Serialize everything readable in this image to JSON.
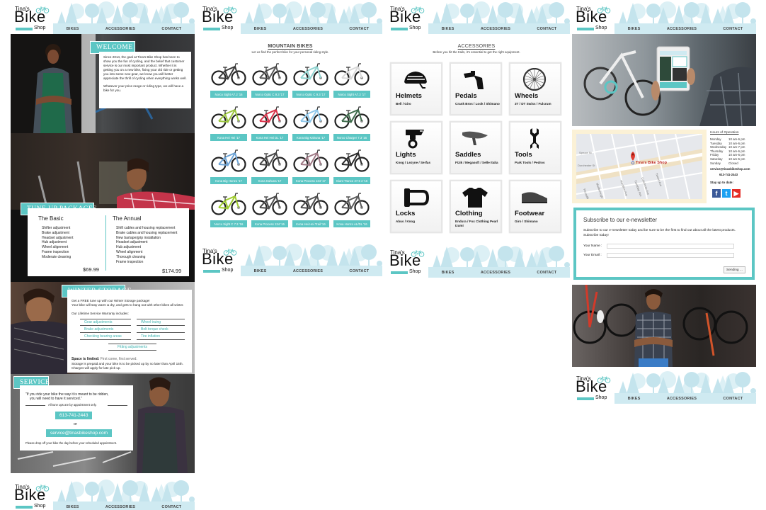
{
  "brand": {
    "name_top": "Tina's",
    "name_main": "Bike",
    "name_bottom": "Shop"
  },
  "nav": {
    "items": [
      "BIKES",
      "ACCESSORIES",
      "CONTACT"
    ]
  },
  "colors": {
    "accent": "#5cc6c4",
    "nav_band": "#cfeaf1",
    "tree_light": "#c9e6ee",
    "map_frame": "#fbf1d6"
  },
  "home": {
    "welcome": {
      "title": "WELCOME",
      "paragraph1": "Since 2014, the goal at Tina's Bike Shop has been to show you the fun of cycling, and the belief that customer service is our most important product. Whether it is getting you on a new bike, fixing your old ride or getting you into some new gear, we know you will better appreciate the thrill of cycling when everything works well.",
      "paragraph2": "Whatever your price range or riding type, we will have a bike for you."
    },
    "tuneup": {
      "title": "TUNE UP PACKAGES",
      "basic": {
        "name": "The Basic",
        "items": [
          "Shifter adjustment",
          "Brake adjustment",
          "Headset adjustment",
          "Hub adjustment",
          "Wheel alignment",
          "Frame inspection",
          "Moderate cleaning"
        ],
        "price": "$69.99"
      },
      "annual": {
        "name": "The Annual",
        "items": [
          "Shift cables and housing replacement",
          "Brake cables and housing replacement",
          "New bartape/grip installation",
          "Headset adjustment",
          "Hub adjustment",
          "Wheel alignment",
          "Thorough cleaning",
          "Frame inspection"
        ],
        "price": "$174.99"
      }
    },
    "winter": {
      "title": "WINTER STORAGE",
      "intro1": "Get a FREE tune up with our Winter Storage package!",
      "intro2": "Your bike will stay warm & dry, and gets to hang out with other bikes all winter.",
      "warranty_heading": "Our Lifetime Service Warranty includes:",
      "warranty_items": [
        "Gear adjustments",
        "Wheel truing",
        "Brake adjustments",
        "Bolt torque check",
        "Checking bearing areas",
        "Tire inflation",
        "Fitting adjustments"
      ],
      "limited_bold": "Space is limited:",
      "limited_rest": " First come, first served.",
      "note1": "Storage is prepaid and your bike is to be picked up by no later than April 15th.",
      "note2": "Charges will apply for late pick up."
    },
    "service": {
      "title": "SERVICE",
      "quote1": "\"If you ride your bike the way it is meant to be ridden,",
      "quote2": "you will need to have it serviced.\"",
      "appointment": "All tune ups are by appointment only.",
      "phone": "613-741-2443",
      "or": "or",
      "email": "service@tinasbikeshop.com",
      "dropoff": "Please drop off your bike the day before your scheduled appointment."
    }
  },
  "bikes": {
    "title": "MOUNTAIN BIKES",
    "subtitle": "Let us find the perfect bike for your personal riding style.",
    "items": [
      {
        "label": "Norco Sight A7.2 '16",
        "color": "#3b3b3b"
      },
      {
        "label": "Norco Optic C 9.3 '17",
        "color": "#555555"
      },
      {
        "label": "Norco Optic C 9.3 '17",
        "color": "#8fd3d0"
      },
      {
        "label": "Norco Sight A7.2 '17",
        "color": "#d8d8d8"
      },
      {
        "label": "Kona Hei Hei '17",
        "color": "#9bc53d"
      },
      {
        "label": "Kona Hei Hei DL '17",
        "color": "#d9334a"
      },
      {
        "label": "Kona Big Kahuna '17",
        "color": "#8fc7ea"
      },
      {
        "label": "Norco Charger 7.3 '16",
        "color": "#3e6b4c"
      },
      {
        "label": "Kona Big Honzo '17",
        "color": "#6ea4d6"
      },
      {
        "label": "Kona Kahuna '17",
        "color": "#4a4a4a"
      },
      {
        "label": "Kona Process 134 '17",
        "color": "#a07a86"
      },
      {
        "label": "Giant Trance 27.5 2 '16",
        "color": "#2c2c2c"
      },
      {
        "label": "Norco Sight C 7.3 '16",
        "color": "#9fcc2e"
      },
      {
        "label": "Kona Process 134 '16",
        "color": "#4a4a4a"
      },
      {
        "label": "Kona Hei Hei Trail '16",
        "color": "#505050"
      },
      {
        "label": "Kona Honzo AL/DL '16",
        "color": "#5a5a5a"
      }
    ]
  },
  "accessories": {
    "title": "ACCESSORIES",
    "subtitle": "Before you hit the trails, it's essential to get the right equipment.",
    "items": [
      {
        "name": "Helmets",
        "brands": "Bell / Giro",
        "icon": "helmet-icon"
      },
      {
        "name": "Pedals",
        "brands": "Crank Bros / Look / Shimano",
        "icon": "pedal-icon"
      },
      {
        "name": "Wheels",
        "brands": "3T / DT Swiss / Fulcrum",
        "icon": "wheel-icon"
      },
      {
        "name": "Lights",
        "brands": "Knog / Lezyne / Serfas",
        "icon": "light-icon"
      },
      {
        "name": "Saddles",
        "brands": "Fizik / Megasoft / Selle Italia",
        "icon": "saddle-icon"
      },
      {
        "name": "Tools",
        "brands": "Park Tools / Pedros",
        "icon": "wrench-icon"
      },
      {
        "name": "Locks",
        "brands": "Abus / Knog",
        "icon": "lock-icon"
      },
      {
        "name": "Clothing",
        "brands": "Endura / Fox Clothing Pearl Izumi",
        "icon": "shirt-icon"
      },
      {
        "name": "Footwear",
        "brands": "Giro / Shimano",
        "icon": "shoe-icon"
      }
    ]
  },
  "contact": {
    "map": {
      "marker_label": "Tina's Bike Shop",
      "streets": [
        "Tremblay Ave",
        "Caledonia Ave",
        "Hamilton Ave",
        "Tweed Ave",
        "Dorchester St",
        "Marlborough Ave",
        "Spruce St",
        "Piccadilly Ave"
      ]
    },
    "hours_title": "Hours of Operation",
    "hours": [
      {
        "day": "Monday",
        "time": "10 am-6 pm"
      },
      {
        "day": "Tuesday",
        "time": "10 am-6 pm"
      },
      {
        "day": "Wednesday",
        "time": "10 am-7 pm"
      },
      {
        "day": "Thursday",
        "time": "10 am-6 pm"
      },
      {
        "day": "Friday",
        "time": "10 am-6 pm"
      },
      {
        "day": "Saturday",
        "time": "10 am-5 pm"
      },
      {
        "day": "Sunday",
        "time": "Closed"
      }
    ],
    "email": "service@tinasbikeshop.com",
    "phone": "613-741-2443",
    "stay_up": "Stay up to date:",
    "social": [
      {
        "name": "facebook",
        "glyph": "f",
        "color": "#3b5998"
      },
      {
        "name": "twitter",
        "glyph": "t",
        "color": "#1da1f2"
      },
      {
        "name": "youtube",
        "glyph": "▶",
        "color": "#e52d27"
      }
    ],
    "newsletter": {
      "title": "Subscribe to our e-newsletter",
      "text": "Subscribe to our e-newsletter today and be sure to be the first to find out about all the latest products. Subscribe today!",
      "name_label": "Your Name :",
      "name_value": "",
      "email_label": "Your Email :",
      "email_value": "",
      "button": "Sending ..."
    }
  }
}
